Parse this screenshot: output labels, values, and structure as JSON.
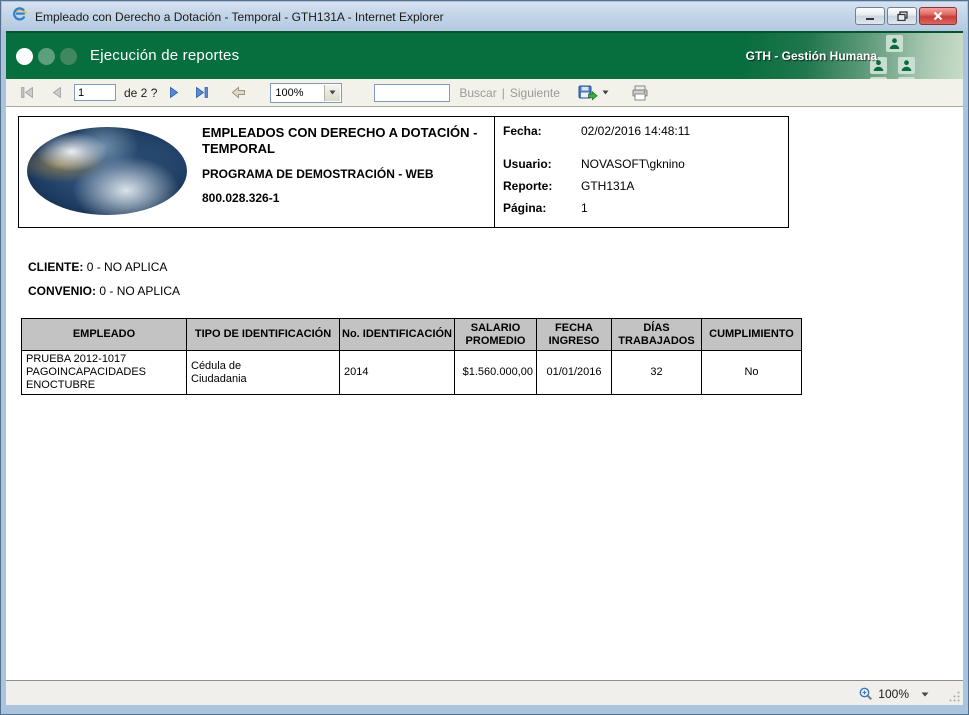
{
  "window": {
    "title": "Empleado con Derecho a Dotación - Temporal - GTH131A - Internet Explorer"
  },
  "header": {
    "title": "Ejecución de reportes",
    "brand": "GTH - Gestión Humana"
  },
  "toolbar": {
    "page_value": "1",
    "page_total_label": "de 2 ?",
    "zoom_value": "100%",
    "search_value": "",
    "find_label": "Buscar",
    "find_separator": "|",
    "next_label": "Siguiente"
  },
  "report": {
    "header": {
      "title": "EMPLEADOS CON DERECHO A DOTACIÓN - TEMPORAL",
      "subtitle": "PROGRAMA DE DEMOSTRACIÓN - WEB",
      "company_id": "800.028.326-1",
      "fields": [
        {
          "label": "Fecha:",
          "value": "02/02/2016 14:48:11"
        },
        {
          "label": "Usuario:",
          "value": "NOVASOFT\\gknino"
        },
        {
          "label": "Reporte:",
          "value": "GTH131A"
        },
        {
          "label": "Página:",
          "value": "1"
        }
      ]
    },
    "filters": [
      {
        "label": "CLIENTE:",
        "value": "0 - NO APLICA"
      },
      {
        "label": "CONVENIO:",
        "value": "0 - NO APLICA"
      }
    ],
    "table": {
      "columns": [
        "EMPLEADO",
        "TIPO DE IDENTIFICACIÓN",
        "No. IDENTIFICACIÓN",
        "SALARIO PROMEDIO",
        "FECHA INGRESO",
        "DÍAS TRABAJADOS",
        "CUMPLIMIENTO"
      ],
      "rows": [
        [
          "PRUEBA 2012-1017 PAGOINCAPACIDADES ENOCTUBRE",
          "Cédula de Ciudadania",
          "2014",
          "$1.560.000,00",
          "01/01/2016",
          "32",
          "No"
        ]
      ]
    }
  },
  "statusbar": {
    "zoom_label": "100%"
  },
  "colors": {
    "header_green": "#076e3e",
    "table_header_bg": "#c3c3c3",
    "titlebar_blue": "#c3d5e8"
  }
}
